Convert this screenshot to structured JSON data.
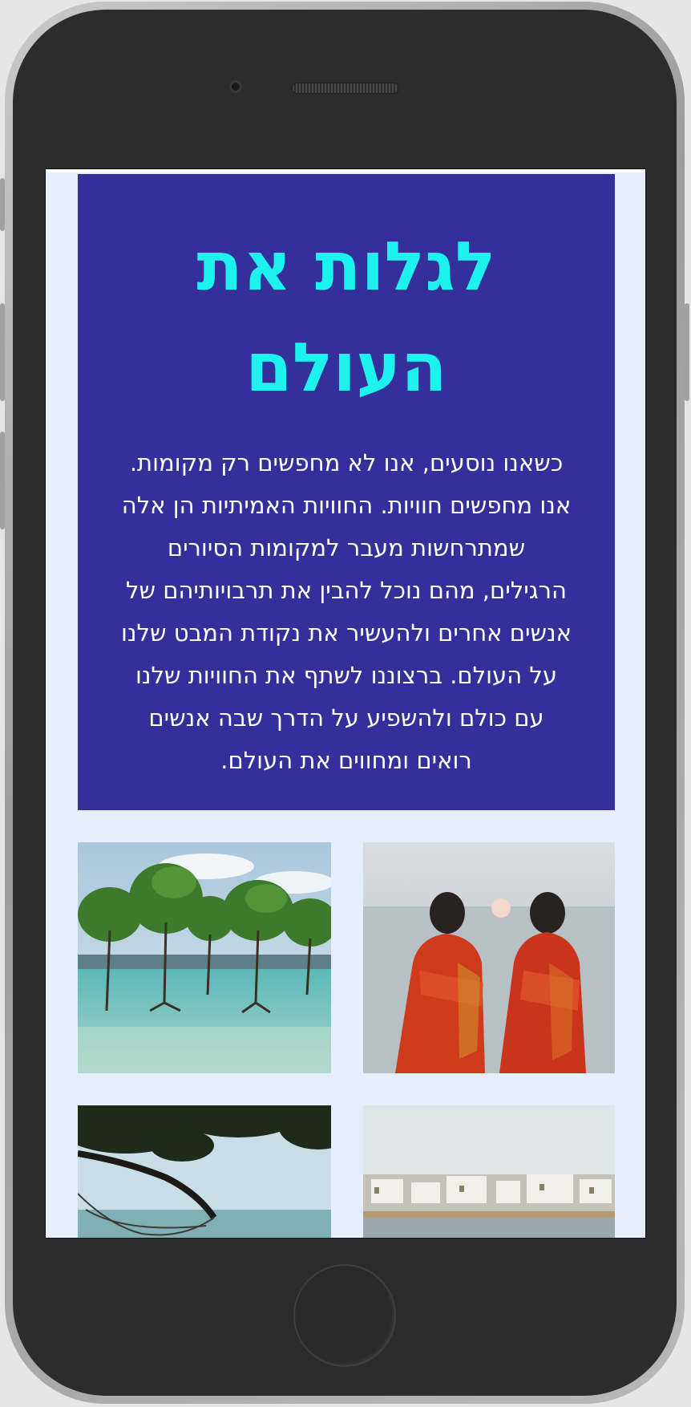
{
  "hero": {
    "title_line1": "לגלות את",
    "title_line2": "העולם",
    "paragraph": [
      "כשאנו נוסעים, אנו לא מחפשים רק מקומות.",
      "אנו מחפשים חוויות. החוויות האמיתיות הן אלה",
      "שמתרחשות מעבר למקומות הסיורים",
      "הרגילים, מהם נוכל להבין את תרבויותיהם של",
      "אנשים אחרים ולהעשיר את נקודת המבט שלנו",
      "על העולם. ברצוננו לשתף את החוויות שלנו",
      "עם כולם ולהשפיע על הדרך שבה אנשים",
      "רואים ומחווים את העולם."
    ]
  },
  "colors": {
    "hero_background": "#33309b",
    "title": "#1ef2ee",
    "screen_background": "#e6eefc"
  }
}
